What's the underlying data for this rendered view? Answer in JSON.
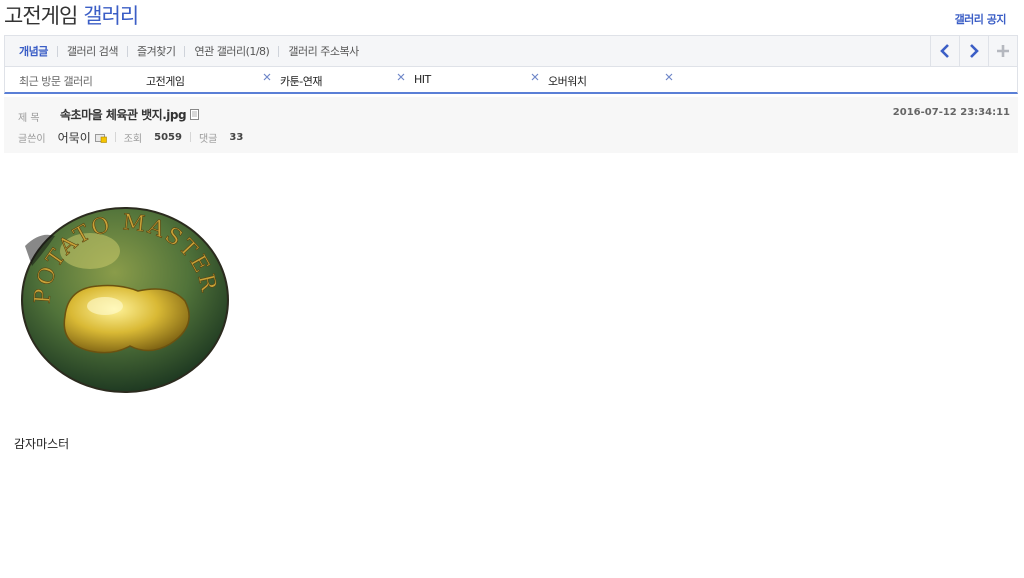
{
  "header": {
    "title": "고전게임",
    "title_accent": "갤러리",
    "notice_link": "갤러리 공지"
  },
  "toolbar": {
    "tabs": [
      {
        "label": "개념글"
      },
      {
        "label": "갤러리 검색"
      },
      {
        "label": "즐겨찾기"
      },
      {
        "label": "연관 갤러리(1/8)"
      },
      {
        "label": "갤러리 주소복사"
      }
    ],
    "nav_icons": [
      "chevron-left-icon",
      "chevron-right-icon",
      "plus-icon"
    ]
  },
  "recent": {
    "label": "최근 방문 갤러리",
    "items": [
      {
        "label": "고전게임"
      },
      {
        "label": "카툰-연재"
      },
      {
        "label": "HIT"
      },
      {
        "label": "오버워치"
      }
    ]
  },
  "post": {
    "title_label": "제 목",
    "title": "속초마을 체육관 뱃지.jpg",
    "date": "2016-07-12 23:34:11",
    "author_label": "글쓴이",
    "author": "어묵이",
    "views_label": "조회",
    "views": "5059",
    "comments_label": "댓글",
    "comments": "33",
    "image_text": "POTATO MASTER",
    "body": "감자마스터"
  },
  "colors": {
    "accent": "#3b5ec6",
    "divider": "#5a7fd6"
  }
}
